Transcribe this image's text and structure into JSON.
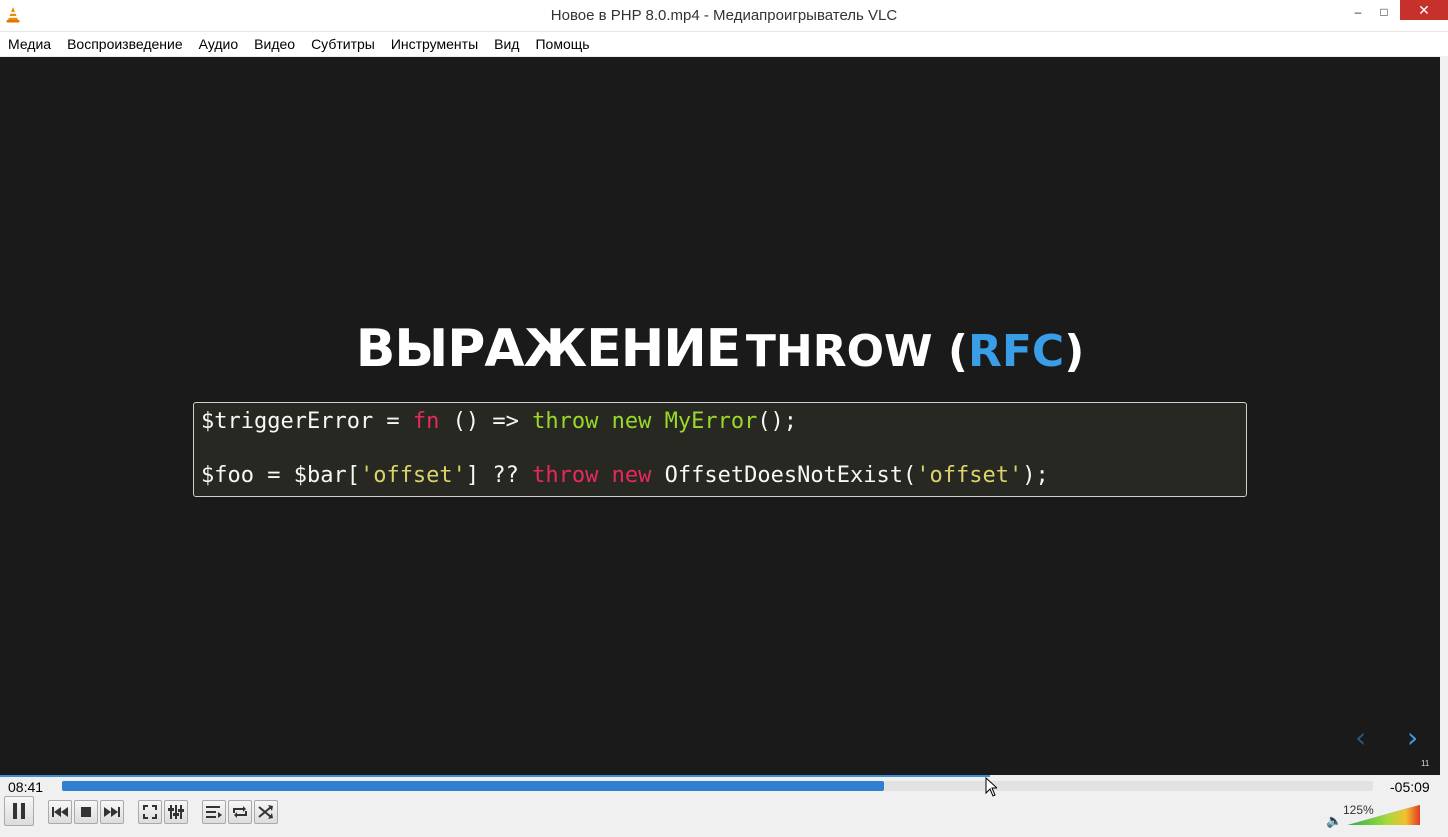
{
  "window": {
    "title": "Новое в PHP 8.0.mp4 - Медиапроигрыватель VLC",
    "controls": {
      "minimize": "–",
      "maximize": "□",
      "close": "✕"
    }
  },
  "menu": {
    "items": [
      "Медиа",
      "Воспроизведение",
      "Аудио",
      "Видео",
      "Субтитры",
      "Инструменты",
      "Вид",
      "Помощь"
    ]
  },
  "slide": {
    "title_word1": "ВЫРАЖЕНИЕ",
    "title_word2": "THROW (",
    "title_link": "RFC",
    "title_close": ")",
    "code": {
      "line1": [
        {
          "t": "$triggerError = ",
          "c": ""
        },
        {
          "t": "fn",
          "c": "kw-pink"
        },
        {
          "t": " () => ",
          "c": ""
        },
        {
          "t": "throw new MyError",
          "c": "kw-green"
        },
        {
          "t": "();",
          "c": ""
        }
      ],
      "line2": [
        {
          "t": "$foo = $bar[",
          "c": ""
        },
        {
          "t": "'offset'",
          "c": "str"
        },
        {
          "t": "] ?? ",
          "c": ""
        },
        {
          "t": "throw new",
          "c": "kw-pink"
        },
        {
          "t": " OffsetDoesNotExist(",
          "c": ""
        },
        {
          "t": "'offset'",
          "c": "str"
        },
        {
          "t": ");",
          "c": ""
        }
      ]
    },
    "nav_prev": "‹",
    "nav_next": "›",
    "slide_number": "11"
  },
  "player": {
    "elapsed": "08:41",
    "remaining": "-05:09",
    "progress": 0.627,
    "volume_label": "125%",
    "volume_level": 1.25,
    "accent_color": "#2f7fd3",
    "buttons": [
      "pause-icon",
      "previous-icon",
      "stop-icon",
      "next-icon",
      "fullscreen-icon",
      "extended-settings-icon",
      "playlist-icon",
      "loop-icon",
      "shuffle-icon"
    ]
  }
}
